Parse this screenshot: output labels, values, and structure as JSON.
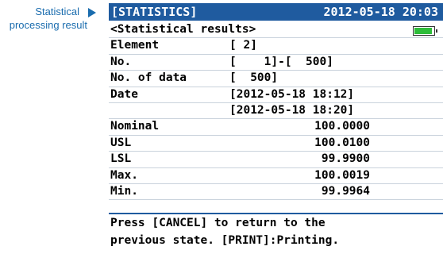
{
  "callout": {
    "line1": "Statistical",
    "line2": "processing result"
  },
  "titlebar": {
    "title": "[STATISTICS]",
    "datetime": "2012-05-18 20:03"
  },
  "header": "<Statistical results>",
  "battery_level": 0.9,
  "rows": [
    {
      "label": "Element",
      "value": "[ 2]"
    },
    {
      "label": "No.",
      "value": "[    1]-[  500]"
    },
    {
      "label": "No. of data",
      "value": "[  500]"
    },
    {
      "label": "Date",
      "value": "[2012-05-18 18:12]"
    },
    {
      "label": "",
      "value": "[2012-05-18 18:20]"
    },
    {
      "label": "Nominal",
      "value": "100.0000"
    },
    {
      "label": "USL",
      "value": "100.0100"
    },
    {
      "label": "LSL",
      "value": "99.9900"
    },
    {
      "label": "Max.",
      "value": "100.0019"
    },
    {
      "label": "Min.",
      "value": "99.9964"
    }
  ],
  "footer": {
    "line1": "Press [CANCEL] to return to the",
    "line2": "previous state. [PRINT]:Printing."
  },
  "colors": {
    "titlebar_bg": "#1f5b9f",
    "callout": "#1a6cae",
    "battery": "#2fbd3a"
  }
}
